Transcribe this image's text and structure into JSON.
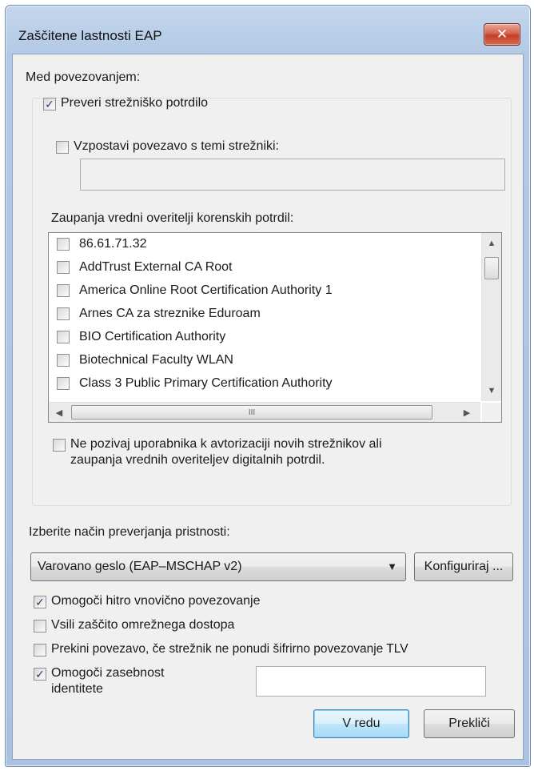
{
  "window": {
    "title": "Zaščitene lastnosti EAP",
    "close_glyph": "✕"
  },
  "connection": {
    "heading": "Med povezovanjem:",
    "verify_server_cert": {
      "label": "Preveri strežniško potrdilo",
      "checked": true
    },
    "connect_to_servers": {
      "label": "Vzpostavi povezavo s temi strežniki:",
      "checked": false,
      "value": ""
    },
    "trusted_roots_label": "Zaupanja vredni overitelji korenskih potrdil:",
    "trusted_roots": [
      {
        "label": "86.61.71.32",
        "checked": false
      },
      {
        "label": "AddTrust External CA Root",
        "checked": false
      },
      {
        "label": "America Online Root Certification Authority 1",
        "checked": false
      },
      {
        "label": "Arnes CA za streznike Eduroam",
        "checked": false
      },
      {
        "label": "BIO Certification Authority",
        "checked": false
      },
      {
        "label": "Biotechnical Faculty WLAN",
        "checked": false
      },
      {
        "label": "Class 3 Public Primary Certification Authority",
        "checked": false
      }
    ],
    "hscroll_grip": "III",
    "do_not_prompt": {
      "label_line1": "Ne pozivaj uporabnika k avtorizaciji novih strežnikov ali",
      "label_line2": "zaupanja vrednih overiteljev digitalnih potrdil.",
      "checked": false
    }
  },
  "auth_method": {
    "label": "Izberite način preverjanja pristnosti:",
    "selected": "Varovano geslo (EAP–MSCHAP v2)",
    "configure_label": "Konfiguriraj ..."
  },
  "options": {
    "fast_reconnect": {
      "label": "Omogoči hitro vnovično povezovanje",
      "checked": true
    },
    "enforce_nap": {
      "label": "Vsili zaščito omrežnega dostopa",
      "checked": false
    },
    "disconnect_no_tlv": {
      "label": "Prekini povezavo, če strežnik ne ponudi šifrirno povezovanje TLV",
      "checked": false
    },
    "identity_privacy": {
      "label_line1": "Omogoči zasebnost",
      "label_line2": "identitete",
      "checked": true,
      "value": ""
    }
  },
  "buttons": {
    "ok_label": "V redu",
    "cancel_label": "Prekliči"
  },
  "glyphs": {
    "check": "✓",
    "arrow_up": "▲",
    "arrow_down": "▼",
    "arrow_left": "◀",
    "arrow_right": "▶",
    "combo_arrow": "▼"
  }
}
